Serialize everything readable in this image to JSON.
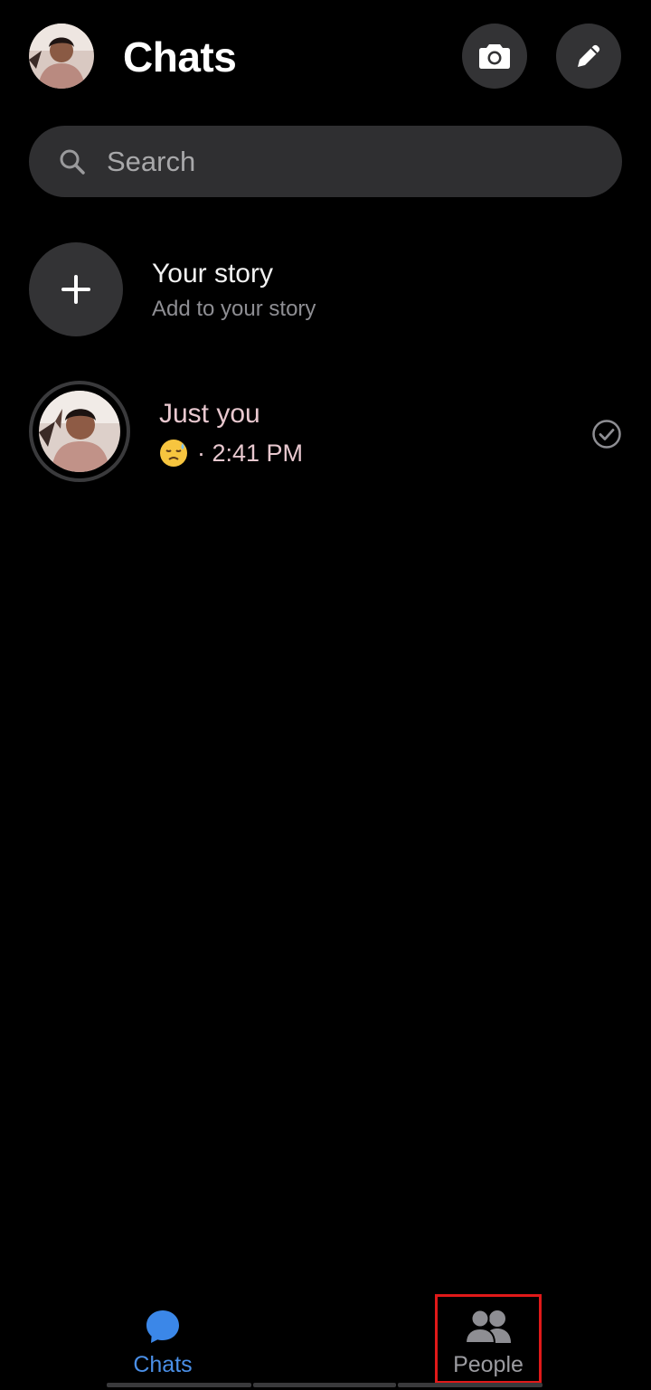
{
  "header": {
    "title": "Chats",
    "profile_avatar": "user-avatar",
    "camera_button_icon": "camera-icon",
    "compose_button_icon": "pencil-icon"
  },
  "search": {
    "placeholder": "Search",
    "icon": "search-icon"
  },
  "story": {
    "title": "Your story",
    "subtitle": "Add to your story",
    "icon": "plus-icon"
  },
  "chats": [
    {
      "name": "Just you",
      "emoji": "downcast-face-with-sweat",
      "time": "· 2:41 PM",
      "status_icon": "read-check-icon"
    }
  ],
  "bottom_nav": {
    "tabs": [
      {
        "label": "Chats",
        "icon": "chat-bubble-icon",
        "active": true
      },
      {
        "label": "People",
        "icon": "people-icon",
        "active": false
      }
    ]
  },
  "colors": {
    "background": "#000000",
    "surface": "#2f2f31",
    "accent": "#4a8fe7",
    "chat_text": "#e8c8cf",
    "highlight": "#e01919"
  }
}
